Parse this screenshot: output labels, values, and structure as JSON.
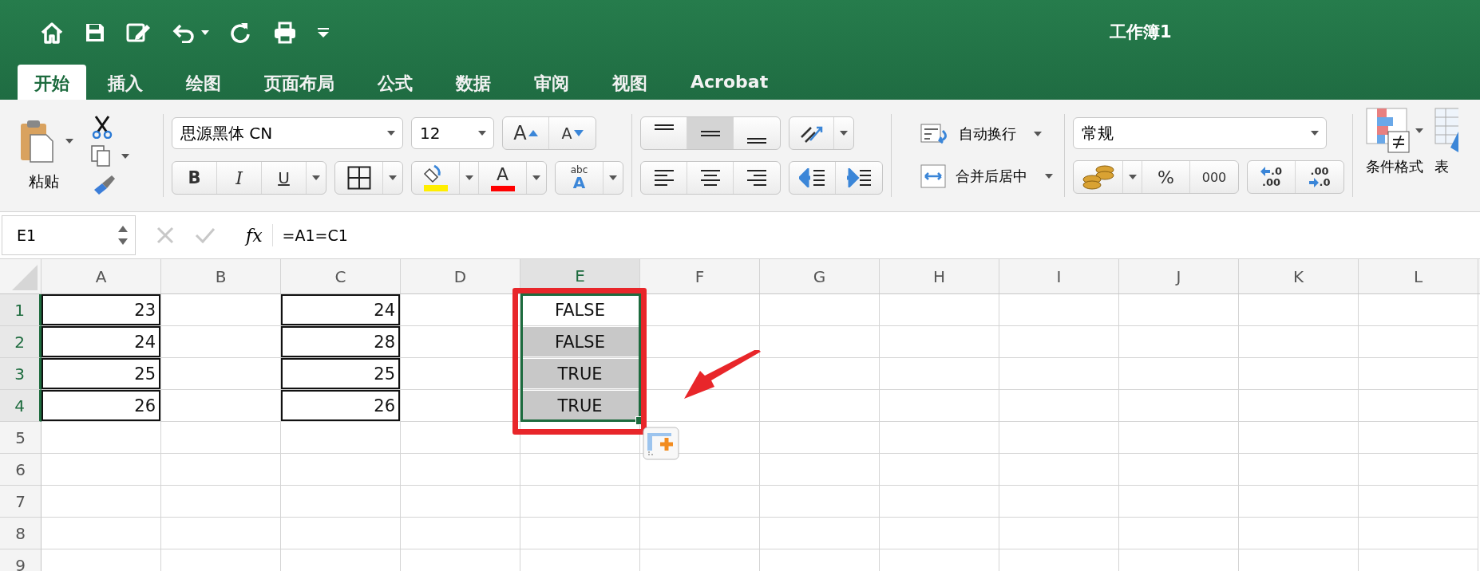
{
  "window": {
    "title": "工作簿1"
  },
  "tabs": [
    {
      "label": "开始",
      "selected": true
    },
    {
      "label": "插入",
      "selected": false
    },
    {
      "label": "绘图",
      "selected": false
    },
    {
      "label": "页面布局",
      "selected": false
    },
    {
      "label": "公式",
      "selected": false
    },
    {
      "label": "数据",
      "selected": false
    },
    {
      "label": "审阅",
      "selected": false
    },
    {
      "label": "视图",
      "selected": false
    },
    {
      "label": "Acrobat",
      "selected": false
    }
  ],
  "ribbon": {
    "paste_label": "粘贴",
    "font": {
      "name": "思源黑体 CN",
      "size": "12",
      "grow": "A",
      "shrink": "A",
      "bold": "B",
      "italic": "I",
      "underline": "U",
      "font_color": "A",
      "phonetic_top": "abc",
      "phonetic_bottom": "A"
    },
    "vertical_align": [
      {
        "selected": false
      },
      {
        "selected": true
      },
      {
        "selected": false
      }
    ],
    "wrap_text": "自动换行",
    "merge_center": "合并后居中",
    "number": {
      "format": "常规",
      "percent": "%",
      "thousands": "000",
      "increase_decimal": [
        ".0",
        ".00"
      ],
      "decrease_decimal": [
        ".00",
        ".0"
      ]
    },
    "conditional_format": "条件格式",
    "format_table": "表"
  },
  "formula_bar": {
    "name_box": "E1",
    "fx": "fx",
    "formula": "=A1=C1"
  },
  "sheet": {
    "columns": [
      {
        "label": "A",
        "selected": false,
        "cells": [
          {
            "value": "23",
            "kind": "number",
            "bordered": true,
            "selected": false
          },
          {
            "value": "24",
            "kind": "number",
            "bordered": true,
            "selected": false
          },
          {
            "value": "25",
            "kind": "number",
            "bordered": true,
            "selected": false
          },
          {
            "value": "26",
            "kind": "number",
            "bordered": true,
            "selected": false
          }
        ]
      },
      {
        "label": "B",
        "selected": false
      },
      {
        "label": "C",
        "selected": false,
        "cells": [
          {
            "value": "24",
            "kind": "number",
            "bordered": true,
            "selected": false
          },
          {
            "value": "28",
            "kind": "number",
            "bordered": true,
            "selected": false
          },
          {
            "value": "25",
            "kind": "number",
            "bordered": true,
            "selected": false
          },
          {
            "value": "26",
            "kind": "number",
            "bordered": true,
            "selected": false
          }
        ]
      },
      {
        "label": "D",
        "selected": false
      },
      {
        "label": "E",
        "selected": true,
        "cells": [
          {
            "value": "FALSE",
            "kind": "boolean",
            "bordered": false,
            "selected": false
          },
          {
            "value": "FALSE",
            "kind": "boolean",
            "bordered": false,
            "selected": true
          },
          {
            "value": "TRUE",
            "kind": "boolean",
            "bordered": false,
            "selected": true
          },
          {
            "value": "TRUE",
            "kind": "boolean",
            "bordered": false,
            "selected": true
          }
        ]
      },
      {
        "label": "F",
        "selected": false
      },
      {
        "label": "G",
        "selected": false
      },
      {
        "label": "H",
        "selected": false
      },
      {
        "label": "I",
        "selected": false
      },
      {
        "label": "J",
        "selected": false
      },
      {
        "label": "K",
        "selected": false
      },
      {
        "label": "L",
        "selected": false
      }
    ],
    "rows": [
      {
        "label": "1",
        "selected": true
      },
      {
        "label": "2",
        "selected": true
      },
      {
        "label": "3",
        "selected": true
      },
      {
        "label": "4",
        "selected": true
      },
      {
        "label": "5",
        "selected": false
      },
      {
        "label": "6",
        "selected": false
      },
      {
        "label": "7",
        "selected": false
      },
      {
        "label": "8",
        "selected": false
      },
      {
        "label": "9",
        "selected": false
      }
    ]
  }
}
